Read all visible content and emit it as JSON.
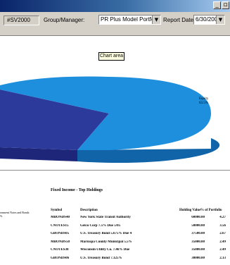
{
  "window": {
    "minimize_glyph": "_",
    "restore_glyph": "▫"
  },
  "toolbar": {
    "account_code": "#SV2000",
    "group_label": "Group/Manager:",
    "group_value": "PR Plus Model Portfolio",
    "report_date_label": "Report Date As Of:",
    "report_date_value": "6/30/2004",
    "dropdown_glyph": "▼"
  },
  "chart": {
    "tooltip": "Chart area",
    "colors": {
      "equity_top": "#1e8fdc",
      "equity_side": "#1264a8",
      "other_top": "#2c3a9c",
      "other_side": "#1d2678"
    }
  },
  "chart_data": {
    "type": "pie",
    "title": "",
    "labels": [
      "Equity"
    ],
    "values": [
      63.5
    ],
    "value_labels": [
      "63.5%"
    ]
  },
  "report": {
    "section_title": "Fixed Income - Top Holdings",
    "left_note": "ernment Notes and Bonds",
    "left_note_value": "%",
    "columns": [
      "Symbol",
      "Description",
      "Holding Value",
      "% of Portfolio"
    ],
    "rows": [
      {
        "symbol": "MBONDS40",
        "description": "New York State Transit Authority",
        "value": "60000.00",
        "pct": "4.27"
      },
      {
        "symbol": "CNOTES15",
        "description": "Geico Corp 7.5% Due 5/05",
        "value": "50000.00",
        "pct": "3.56"
      },
      {
        "symbol": "GBONDS05",
        "description": "U.S. Treasury Bond 5.675% Due 4",
        "value": "37500.00",
        "pct": "2.67"
      },
      {
        "symbol": "MBONDS50",
        "description": "Maricopa County Municipal 5.5%",
        "value": "35000.00",
        "pct": "2.49"
      },
      {
        "symbol": "CNOTES30",
        "description": "Wisconsin Utility Co. 7.46% Due",
        "value": "35000.00",
        "pct": "2.49"
      },
      {
        "symbol": "GBONDS06",
        "description": "U.S. Treasury Bond 7.125%",
        "value": "30000.00",
        "pct": "2.13"
      }
    ]
  }
}
